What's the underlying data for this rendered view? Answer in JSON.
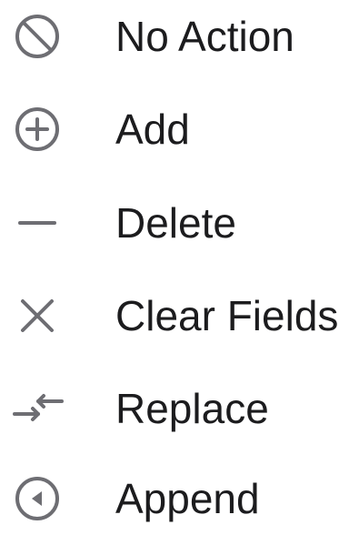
{
  "menu": {
    "icon_color": "#6e6e73",
    "text_color": "#1c1c1e",
    "items": [
      {
        "label": "No Action",
        "icon": "prohibited-icon"
      },
      {
        "label": "Add",
        "icon": "add-circle-icon"
      },
      {
        "label": "Delete",
        "icon": "minus-icon"
      },
      {
        "label": "Clear Fields",
        "icon": "close-x-icon"
      },
      {
        "label": "Replace",
        "icon": "replace-arrows-icon"
      },
      {
        "label": "Append",
        "icon": "append-circle-icon"
      }
    ]
  }
}
